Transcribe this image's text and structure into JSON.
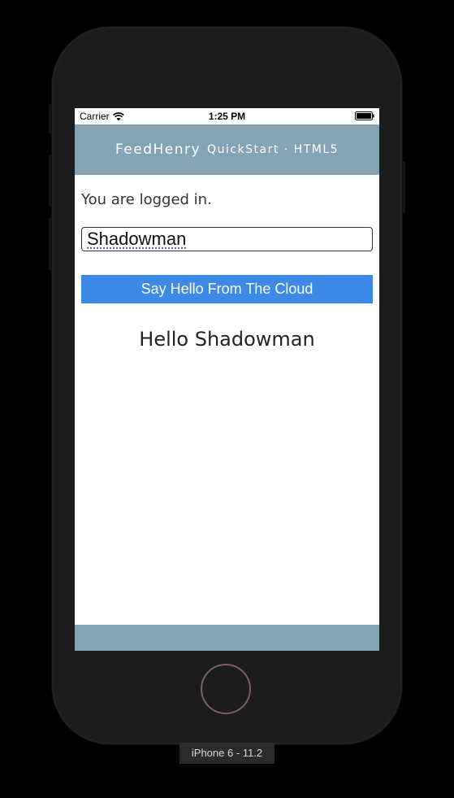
{
  "status_bar": {
    "carrier": "Carrier",
    "time": "1:25 PM"
  },
  "header": {
    "brand": "FeedHenry",
    "subtitle": "QuickStart · HTML5"
  },
  "main": {
    "status_text": "You are logged in.",
    "name_input_value": "Shadowman",
    "cloud_button_label": "Say Hello From The Cloud",
    "greeting": "Hello Shadowman"
  },
  "device": {
    "label": "iPhone 6 - 11.2"
  },
  "colors": {
    "header_bg": "#84a3b5",
    "button_bg": "#3c8ae6",
    "device_body": "#1c1c1c"
  },
  "icons": [
    "wifi-icon",
    "battery-icon"
  ]
}
